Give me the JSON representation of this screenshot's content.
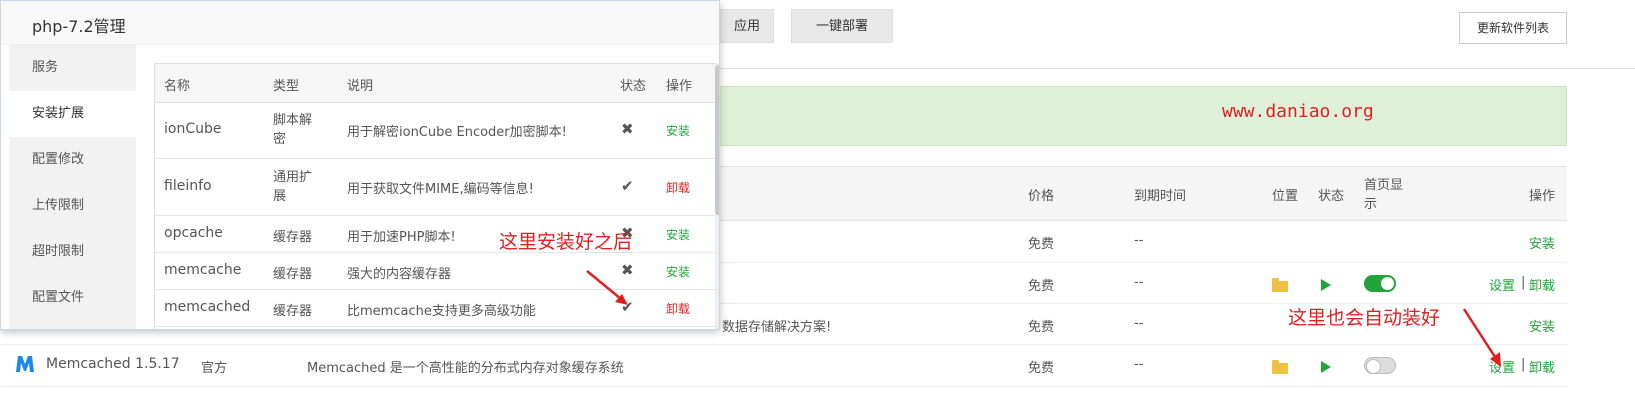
{
  "top_buttons": {
    "apps_label": "应用",
    "deploy_label": "一键部署",
    "refresh_label": "更新软件列表"
  },
  "notice": {
    "watermark": "www.daniao.org"
  },
  "soft_table": {
    "headers": {
      "price": "价格",
      "expire": "到期时间",
      "location": "位置",
      "status": "状态",
      "homepage": "首页显示",
      "ops": "操作"
    },
    "rows": [
      {
        "price": "免费",
        "expire": "--",
        "op_install": "安装"
      },
      {
        "price": "免费",
        "expire": "--",
        "op_settings": "设置",
        "sep": "|",
        "op_uninstall": "卸载"
      },
      {
        "desc_tail": "数据存储解决方案!",
        "price": "免费",
        "expire": "--",
        "op_install": "安装"
      },
      {
        "name": "Memcached 1.5.17",
        "type": "官方",
        "desc": "Memcached 是一个高性能的分布式内存对象缓存系统",
        "price": "免费",
        "expire": "--",
        "op_settings": "设置",
        "sep": "|",
        "op_uninstall": "卸载"
      }
    ]
  },
  "modal": {
    "title": "php-7.2管理",
    "sidebar": [
      "服务",
      "安装扩展",
      "配置修改",
      "上传限制",
      "超时限制",
      "配置文件"
    ],
    "ext_headers": {
      "name": "名称",
      "type": "类型",
      "desc": "说明",
      "status": "状态",
      "op": "操作"
    },
    "extensions": [
      {
        "name": "ionCube",
        "type": "脚本解密",
        "desc": "用于解密ionCube Encoder加密脚本!",
        "status": "✖",
        "op": "安装"
      },
      {
        "name": "fileinfo",
        "type": "通用扩展",
        "desc": "用于获取文件MIME,编码等信息!",
        "status": "✔",
        "op": "卸载"
      },
      {
        "name": "opcache",
        "type": "缓存器",
        "desc": "用于加速PHP脚本!",
        "status": "✖",
        "op": "安装"
      },
      {
        "name": "memcache",
        "type": "缓存器",
        "desc": "强大的内容缓存器",
        "status": "✖",
        "op": "安装"
      },
      {
        "name": "memcached",
        "type": "缓存器",
        "desc": "比memcache支持更多高级功能",
        "status": "✔",
        "op": "卸载"
      }
    ]
  },
  "annotations": {
    "after_install": "这里安装好之后",
    "auto_install": "这里也会自动装好"
  },
  "colors": {
    "green": "#20a53a",
    "red": "#e02020",
    "notice_bg": "#dff0d8"
  }
}
